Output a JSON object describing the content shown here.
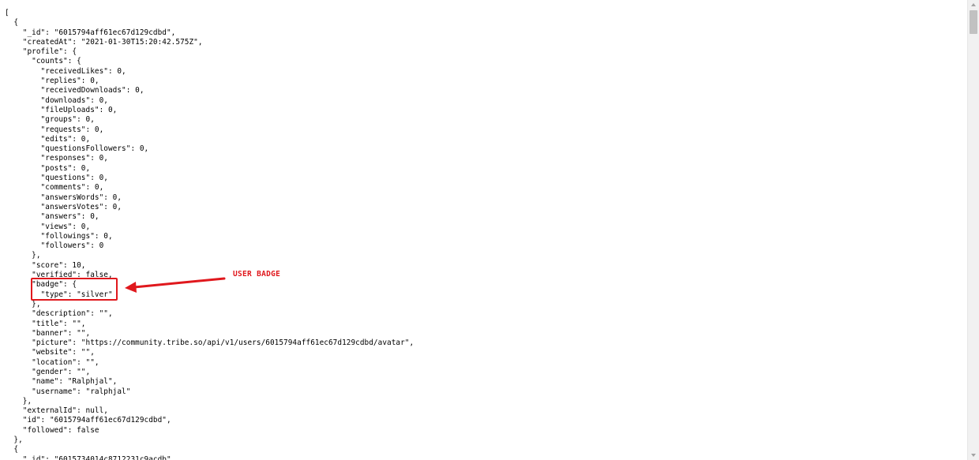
{
  "json_view": {
    "lines": [
      "[",
      "  {",
      "    \"_id\": \"6015794aff61ec67d129cdbd\",",
      "    \"createdAt\": \"2021-01-30T15:20:42.575Z\",",
      "    \"profile\": {",
      "      \"counts\": {",
      "        \"receivedLikes\": 0,",
      "        \"replies\": 0,",
      "        \"receivedDownloads\": 0,",
      "        \"downloads\": 0,",
      "        \"fileUploads\": 0,",
      "        \"groups\": 0,",
      "        \"requests\": 0,",
      "        \"edits\": 0,",
      "        \"questionsFollowers\": 0,",
      "        \"responses\": 0,",
      "        \"posts\": 0,",
      "        \"questions\": 0,",
      "        \"comments\": 0,",
      "        \"answersWords\": 0,",
      "        \"answersVotes\": 0,",
      "        \"answers\": 0,",
      "        \"views\": 0,",
      "        \"followings\": 0,",
      "        \"followers\": 0",
      "      },",
      "      \"score\": 10,",
      "      \"verified\": false,",
      "      \"badge\": {",
      "        \"type\": \"silver\"",
      "      },",
      "      \"description\": \"\",",
      "      \"title\": \"\",",
      "      \"banner\": \"\",",
      "      \"picture\": \"https://community.tribe.so/api/v1/users/6015794aff61ec67d129cdbd/avatar\",",
      "      \"website\": \"\",",
      "      \"location\": \"\",",
      "      \"gender\": \"\",",
      "      \"name\": \"Ralphjal\",",
      "      \"username\": \"ralphjal\"",
      "    },",
      "    \"externalId\": null,",
      "    \"id\": \"6015794aff61ec67d129cdbd\",",
      "    \"followed\": false",
      "  },",
      "  {",
      "    \"_id\": \"6015734014c8712231c9acdb\","
    ]
  },
  "annotation": {
    "label": "USER BADGE",
    "color": "#e0181d"
  }
}
